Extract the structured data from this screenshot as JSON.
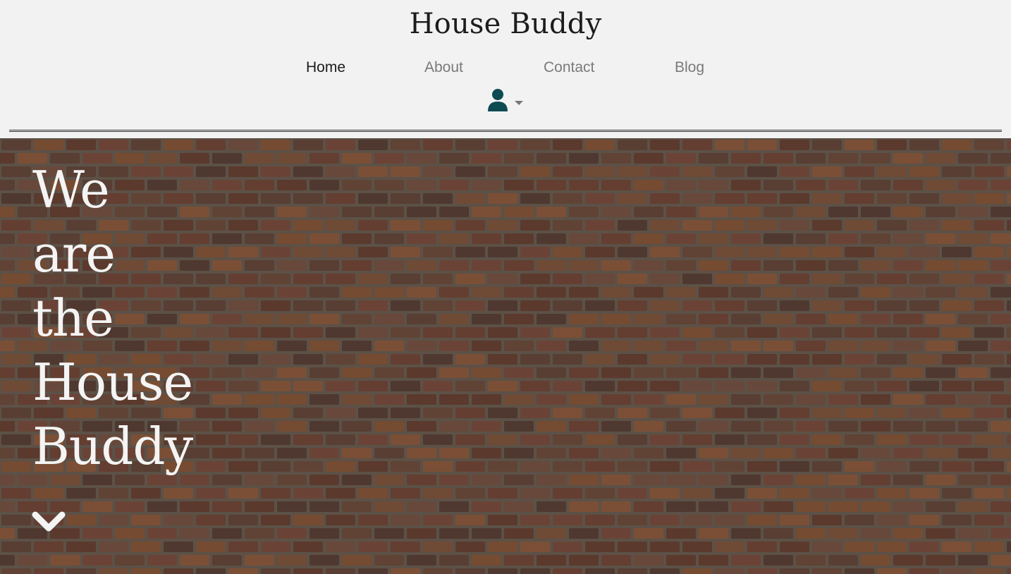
{
  "header": {
    "brand": "House Buddy",
    "nav": {
      "home": "Home",
      "about": "About",
      "contact": "Contact",
      "blog": "Blog"
    },
    "active_item": "Home",
    "account_icon": "user-icon",
    "account_menu_icon": "caret-down-icon"
  },
  "hero": {
    "title_lines": [
      "We",
      "are",
      "the",
      "House",
      "Buddy"
    ],
    "background": "brick-wall-photo",
    "scroll_icon": "chevron-down-icon"
  },
  "colors": {
    "header_bg": "#f2f2f2",
    "brand_text": "#1c1c1c",
    "nav_inactive": "#7a7a7a",
    "user_icon": "#0d4a52",
    "hero_text": "#f4f4f4"
  }
}
